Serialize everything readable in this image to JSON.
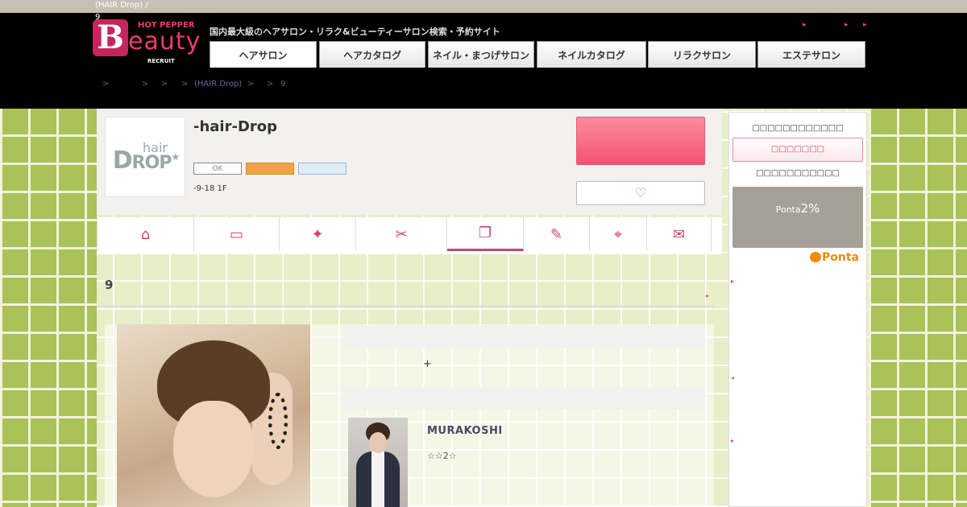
{
  "topstrip": {
    "crumb": "(HAIR Drop) /",
    "num": "9"
  },
  "header": {
    "logo": {
      "hot_pepper": "HOT PEPPER",
      "b": "B",
      "eauty": "eauty",
      "recruit": "RECRUIT"
    },
    "tagline": "国内最大級のヘアサロン・リラク&ビューティーサロン検索・予約サイト",
    "arrows": [
      "▸",
      "▸",
      "▸"
    ],
    "tabs": [
      {
        "label": "ヘアサロン",
        "active": true
      },
      {
        "label": "ヘアカタログ",
        "active": false
      },
      {
        "label": "ネイル・まつげサロン",
        "active": false
      },
      {
        "label": "ネイルカタログ",
        "active": false
      },
      {
        "label": "リラクサロン",
        "active": false
      },
      {
        "label": "エステサロン",
        "active": false
      }
    ]
  },
  "breadcrumb": {
    "seps": [
      ">",
      ">",
      ">",
      ">",
      ">",
      ">"
    ],
    "salon_link": "(HAIR Drop)",
    "last": "9"
  },
  "salon": {
    "logo_hair": "hair",
    "logo_drop_big": "D",
    "logo_drop_rest": "ROP",
    "logo_star": "★",
    "name": "-hair-Drop",
    "chip_ok": "OK",
    "address": "-9-18 1F",
    "fav_icon": "♡"
  },
  "icon_nav": [
    {
      "icon": "home-icon",
      "glyph": "⌂",
      "active": false
    },
    {
      "icon": "coupon-icon",
      "glyph": "▭",
      "active": false
    },
    {
      "icon": "sparkle-icon",
      "glyph": "✦",
      "active": false
    },
    {
      "icon": "scissors-icon",
      "glyph": "✂",
      "active": false
    },
    {
      "icon": "catalog-icon",
      "glyph": "❐",
      "active": true
    },
    {
      "icon": "pencil-icon",
      "glyph": "✎",
      "active": false
    },
    {
      "icon": "map-pin-icon",
      "glyph": "⌖",
      "active": false
    },
    {
      "icon": "chat-icon",
      "glyph": "✉",
      "active": false
    }
  ],
  "section": {
    "title": "9",
    "arrow": "▸"
  },
  "detail": {
    "plus": "+"
  },
  "stylist": {
    "name": "MURAKOSHI",
    "stars": "☆☆2☆"
  },
  "sidebar": {
    "title1": "□□□□□□□□□□□□",
    "button": "□□□□□□□",
    "title2": "□□□□□□□□□□□",
    "ponta_prefix": "Ponta",
    "ponta_rate": "2%",
    "ponta_logo": "Ponta",
    "arrows": [
      "▸",
      "◂",
      "▸"
    ]
  },
  "colors": {
    "accent": "#e24a78",
    "header_bg": "#000000",
    "tile_green": "#a9c25a",
    "book_button": "#f4526f"
  }
}
